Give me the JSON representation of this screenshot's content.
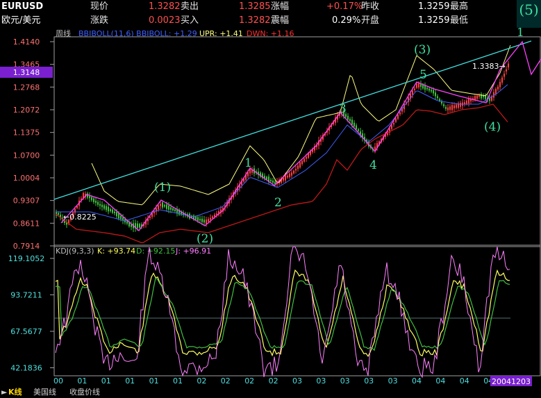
{
  "header": {
    "symbol": "EURUSD",
    "name": "欧元/美元",
    "row1": [
      {
        "label": "现价",
        "value": "1.3282"
      },
      {
        "label": "卖出",
        "value": "1.3285"
      },
      {
        "label": "涨幅",
        "value": "+0.17%"
      },
      {
        "label": "昨收",
        "value": "1.3259"
      },
      {
        "label": "最高",
        "value": ""
      }
    ],
    "row2": [
      {
        "label": "涨跌",
        "value": "0.0023"
      },
      {
        "label": "买入",
        "value": "1.3282"
      },
      {
        "label": "震幅",
        "value": "0.29%"
      },
      {
        "label": "开盘",
        "value": "1.3259"
      },
      {
        "label": "最低",
        "value": ""
      }
    ],
    "corner_label": "(5)"
  },
  "chart_data": [
    {
      "type": "line",
      "title": "周线",
      "legend": [
        {
          "name": "BBIBOLL(11,6)",
          "text": "BBIBOLL(11,6) BBIBOLL: +1.29",
          "color": "#4060ff"
        },
        {
          "name": "UPR",
          "text": "UPR: +1.41",
          "color": "#ffff80"
        },
        {
          "name": "DWN",
          "text": "DWN: +1.16",
          "color": "#ff3030"
        }
      ],
      "ylim": [
        0.7914,
        1.414
      ],
      "yticks": [
        "1.4140",
        "1.3465",
        "1.2768",
        "1.2072",
        "1.1375",
        "1.0700",
        "1.0004",
        "0.9307",
        "0.8611",
        "0.7914"
      ],
      "current_price": "1.3148",
      "annotations": [
        "←0.8225",
        "1.3383→",
        "(1)",
        "(2)",
        "(3)",
        "(4)",
        "(5)",
        "1",
        "2",
        "3",
        "4",
        "5"
      ],
      "colors": {
        "upr": "#ffff80",
        "dwn": "#c01818",
        "mid": "#4060ff",
        "trend": "#40e0e0",
        "wave": "#ff40ff",
        "up_candle": "#ff4040",
        "down_candle": "#40c040",
        "label": "#40e0a0"
      }
    },
    {
      "type": "line",
      "title": "KDJ(9,3,3)",
      "legend": [
        {
          "name": "K",
          "text": "K: +93.74",
          "color": "#ffff60"
        },
        {
          "name": "D",
          "text": "D: +92.15",
          "color": "#40c040"
        },
        {
          "name": "J",
          "text": "J: +96.91",
          "color": "#ff80ff"
        }
      ],
      "yticks": [
        "119.1052",
        "93.7211",
        "67.5677",
        "42.1836",
        "16.0303"
      ],
      "xticks": [
        "00",
        "01",
        "01",
        "01",
        "01",
        "01",
        "02",
        "02",
        "02",
        "02",
        "03",
        "03",
        "03",
        "03",
        "03",
        "04",
        "04",
        "04",
        "04",
        "0"
      ],
      "date_label": "20041203"
    }
  ],
  "footer": {
    "tabs": [
      "K线",
      "美国线",
      "收盘价线"
    ]
  }
}
